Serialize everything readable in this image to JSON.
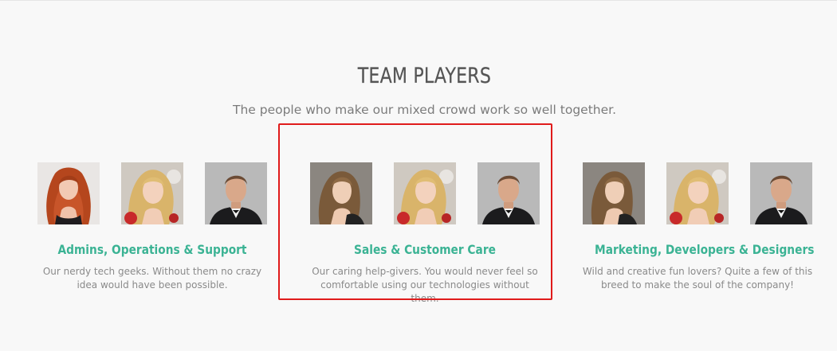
{
  "section": {
    "title": "TEAM PLAYERS",
    "subtitle": "The people who make our mixed crowd work so well together."
  },
  "teams": [
    {
      "name": "Admins, Operations & Support",
      "description": "Our nerdy tech geeks. Without them no crazy idea would have been possible."
    },
    {
      "name": "Sales & Customer Care",
      "description": "Our caring help-givers. You would never feel so comfortable using our technologies without them."
    },
    {
      "name": "Marketing, Developers & Designers",
      "description": "Wild and creative fun lovers? Quite a few of this breed to make the soul of the company!"
    }
  ],
  "colors": {
    "accent": "#3bb394",
    "title": "#555555",
    "body_text": "#8a8a8a",
    "highlight": "#e01b1b",
    "background": "#f8f8f8"
  }
}
